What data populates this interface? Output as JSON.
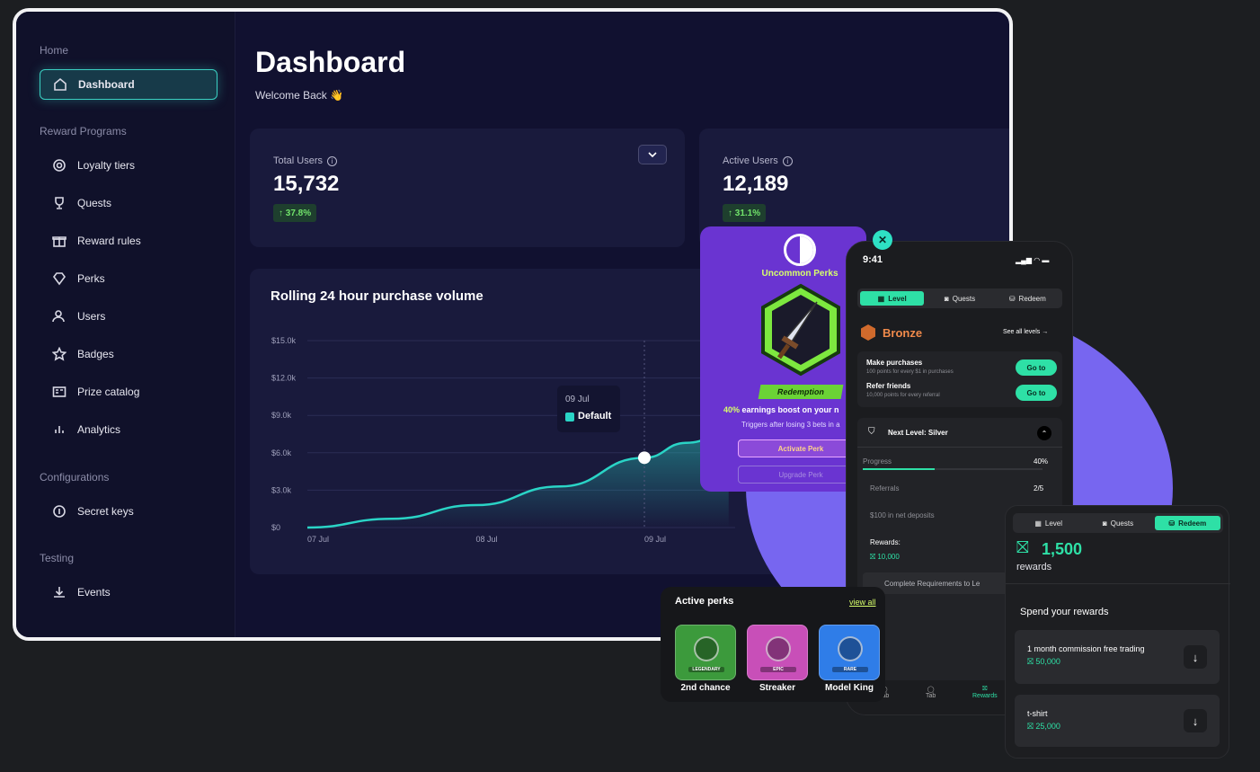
{
  "sidebar": {
    "home_label": "Home",
    "dashboard": "Dashboard",
    "reward_programs_label": "Reward Programs",
    "items": [
      "Loyalty tiers",
      "Quests",
      "Reward rules",
      "Perks",
      "Users",
      "Badges",
      "Prize catalog",
      "Analytics"
    ],
    "configurations_label": "Configurations",
    "secret_keys": "Secret keys",
    "testing_label": "Testing",
    "events": "Events"
  },
  "header": {
    "title": "Dashboard",
    "subtitle": "Welcome Back 👋"
  },
  "stats": {
    "total_users_label": "Total Users",
    "total_users_value": "15,732",
    "total_users_change": "↑ 37.8%",
    "active_users_label": "Active Users",
    "active_users_value": "12,189",
    "active_users_change": "↑ 31.1%"
  },
  "chart_data": {
    "type": "area",
    "title": "Rolling 24 hour purchase volume",
    "y_ticks": [
      "$15.0k",
      "$12.0k",
      "$9.0k",
      "$6.0k",
      "$3.0k",
      "$0"
    ],
    "x_ticks": [
      "07 Jul",
      "08 Jul",
      "09 Jul"
    ],
    "ylim": [
      0,
      15000
    ],
    "series": [
      {
        "name": "Default",
        "x": [
          0,
          0.5,
          1,
          1.5,
          2,
          2.25,
          2.5
        ],
        "y": [
          0,
          700,
          1800,
          3300,
          5600,
          6800,
          7600
        ]
      }
    ],
    "tooltip": {
      "date": "09 Jul",
      "series": "Default"
    },
    "accent": "#2ad4c6"
  },
  "perk_card": {
    "title": "Uncommon Perks",
    "tag": "Redemption",
    "boost_pct": "40%",
    "boost_text": "earnings boost on your n",
    "trigger_text": "Triggers after losing 3 bets in a",
    "activate": "Activate Perk",
    "upgrade": "Upgrade Perk"
  },
  "phone": {
    "time": "9:41",
    "tabs": [
      "Level",
      "Quests",
      "Redeem"
    ],
    "tier": "Bronze",
    "see_all": "See all levels →",
    "tasks": [
      {
        "title": "Make purchases",
        "sub": "100 points for every $1 in purchases",
        "btn": "Go to"
      },
      {
        "title": "Refer friends",
        "sub": "10,000 points for every referral",
        "btn": "Go to"
      }
    ],
    "next_level": "Next Level: Silver",
    "progress_label": "Progress",
    "progress_value": "40%",
    "progress_fraction": 0.4,
    "referrals_label": "Referrals",
    "referrals_value": "2/5",
    "deposits_label": "$100 in net deposits",
    "rewards_label": "Rewards:",
    "rewards_value": "10,000",
    "complete_text": "Complete Requirements to Le",
    "bottom_tabs": [
      "Tab",
      "Tab",
      "Rewards"
    ]
  },
  "active_perks": {
    "title": "Active perks",
    "view_all": "view all",
    "items": [
      {
        "name": "2nd chance",
        "rarity": "LEGENDARY",
        "color": "#3c9a3c"
      },
      {
        "name": "Streaker",
        "rarity": "EPIC",
        "color": "#c84fb8"
      },
      {
        "name": "Model King",
        "rarity": "RARE",
        "color": "#2f7de8"
      }
    ]
  },
  "rewards_panel": {
    "tabs": [
      "Level",
      "Quests",
      "Redeem"
    ],
    "amount": "1,500",
    "amount_label": "rewards",
    "spend_title": "Spend your rewards",
    "items": [
      {
        "name": "1 month commission free trading",
        "cost": "50,000"
      },
      {
        "name": "t-shirt",
        "cost": "25,000"
      }
    ]
  }
}
